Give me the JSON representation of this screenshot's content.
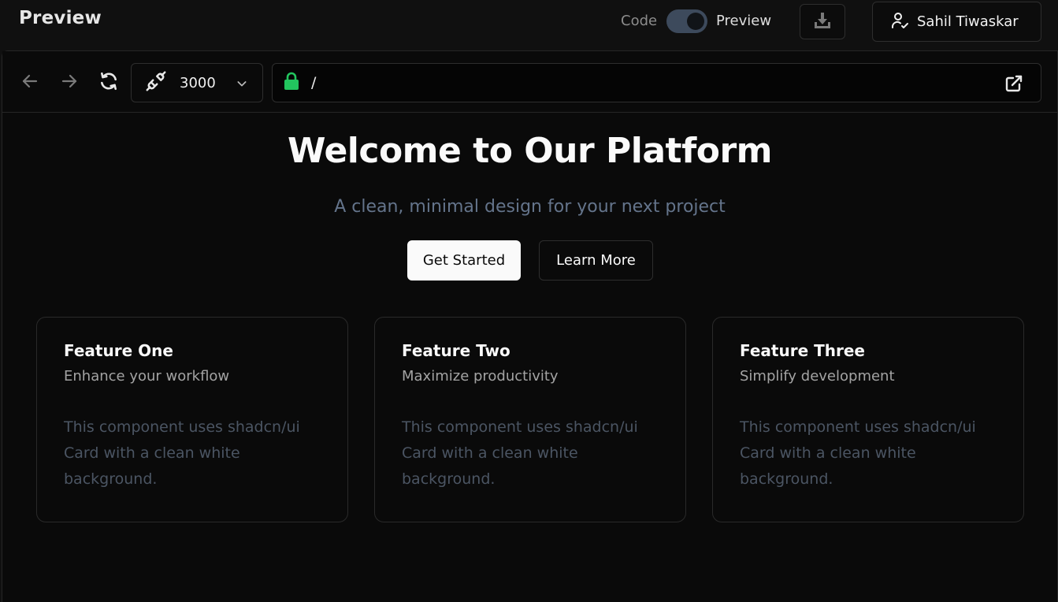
{
  "header": {
    "title": "Preview",
    "mode_code_label": "Code",
    "mode_preview_label": "Preview",
    "user_name": "Sahil Tiwaskar"
  },
  "browser": {
    "port": "3000",
    "url_path": "/"
  },
  "page": {
    "title": "Welcome to Our Platform",
    "subtitle": "A clean, minimal design for your next project",
    "primary_button": "Get Started",
    "secondary_button": "Learn More",
    "cards": [
      {
        "title": "Feature One",
        "description": "Enhance your workflow",
        "body": "This component uses shadcn/ui Card with a clean white background."
      },
      {
        "title": "Feature Two",
        "description": "Maximize productivity",
        "body": "This component uses shadcn/ui Card with a clean white background."
      },
      {
        "title": "Feature Three",
        "description": "Simplify development",
        "body": "This component uses shadcn/ui Card with a clean white background."
      }
    ]
  },
  "icons": {
    "download": "download-icon",
    "user": "user-check-icon",
    "back": "arrow-left-icon",
    "forward": "arrow-right-icon",
    "refresh": "refresh-icon",
    "port": "plug-icon",
    "chevron": "chevron-down-icon",
    "lock": "lock-icon",
    "external": "external-link-icon"
  },
  "colors": {
    "lock_accent": "#22c55e",
    "toggle_track": "#3d4a5c",
    "primary_button_bg": "#fafafa"
  }
}
